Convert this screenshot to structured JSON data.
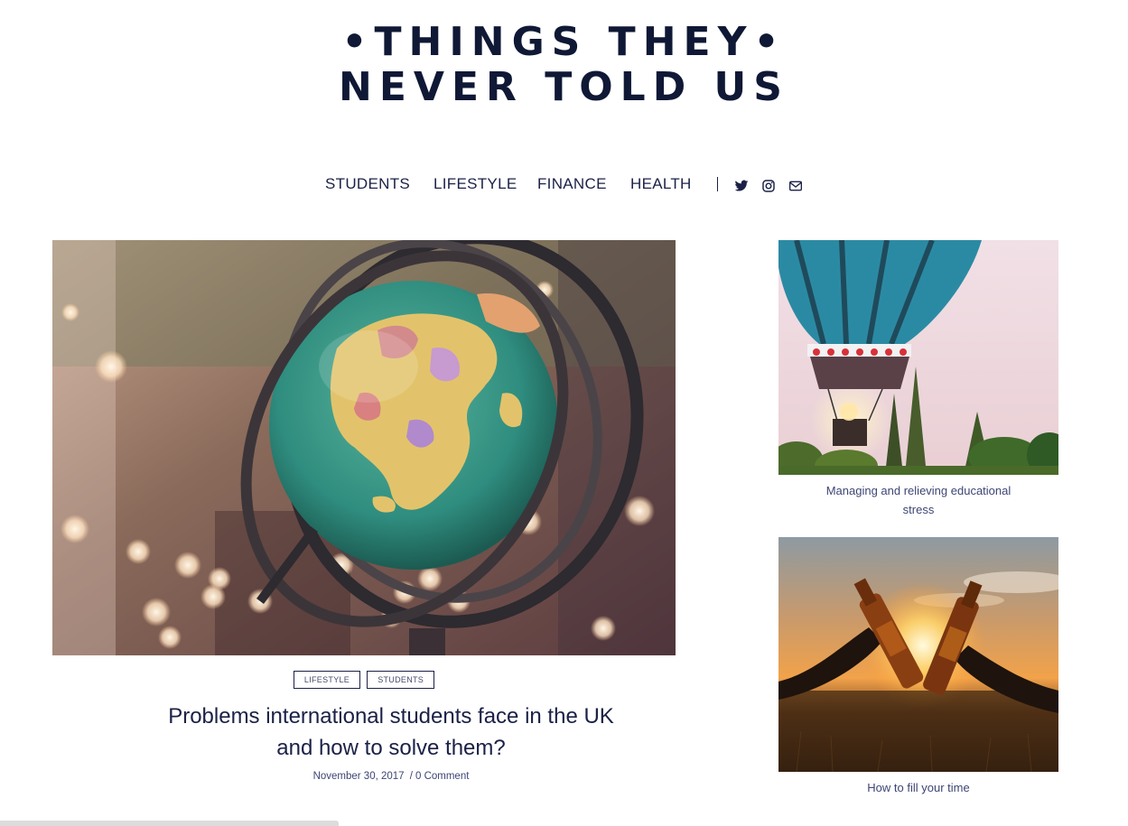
{
  "site": {
    "title_line1": "•THINGS THEY•",
    "title_line2": "NEVER TOLD US"
  },
  "nav": {
    "items": [
      {
        "label": "STUDENTS"
      },
      {
        "label": "LIFESTYLE"
      },
      {
        "label": "FINANCE"
      },
      {
        "label": "HEALTH"
      }
    ],
    "social": [
      "twitter-icon",
      "instagram-icon",
      "mail-icon"
    ]
  },
  "featured": {
    "tags": [
      "LIFESTYLE",
      "STUDENTS"
    ],
    "title_line1": "Problems international students face in the UK",
    "title_line2": "and how to solve them?",
    "date": "November 30, 2017",
    "separator": "/",
    "comments": "0 Comment"
  },
  "sidebar": {
    "posts": [
      {
        "caption_line1": "Managing and relieving educational",
        "caption_line2": "stress"
      },
      {
        "caption_line1": "How to fill your time",
        "caption_line2": ""
      }
    ]
  },
  "colors": {
    "text": "#1b2146",
    "title": "#0f1835"
  }
}
